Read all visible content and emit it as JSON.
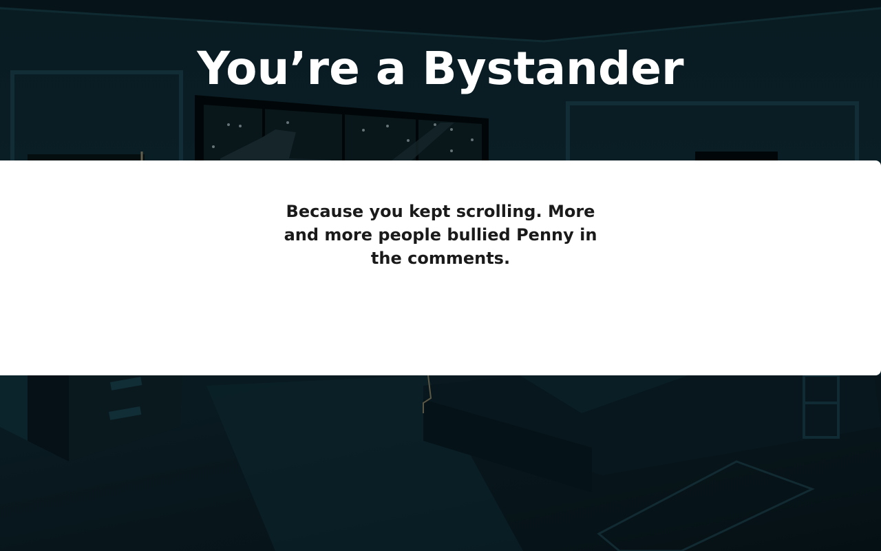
{
  "scene": {
    "title": "You’re a Bystander",
    "message": "Because you kept scrolling. More and more people bullied Penny in the comments."
  },
  "colors": {
    "background_dark": "#0a1a20",
    "panel": "#ffffff",
    "title_text": "#ffffff",
    "body_text": "#1a1a1a"
  }
}
